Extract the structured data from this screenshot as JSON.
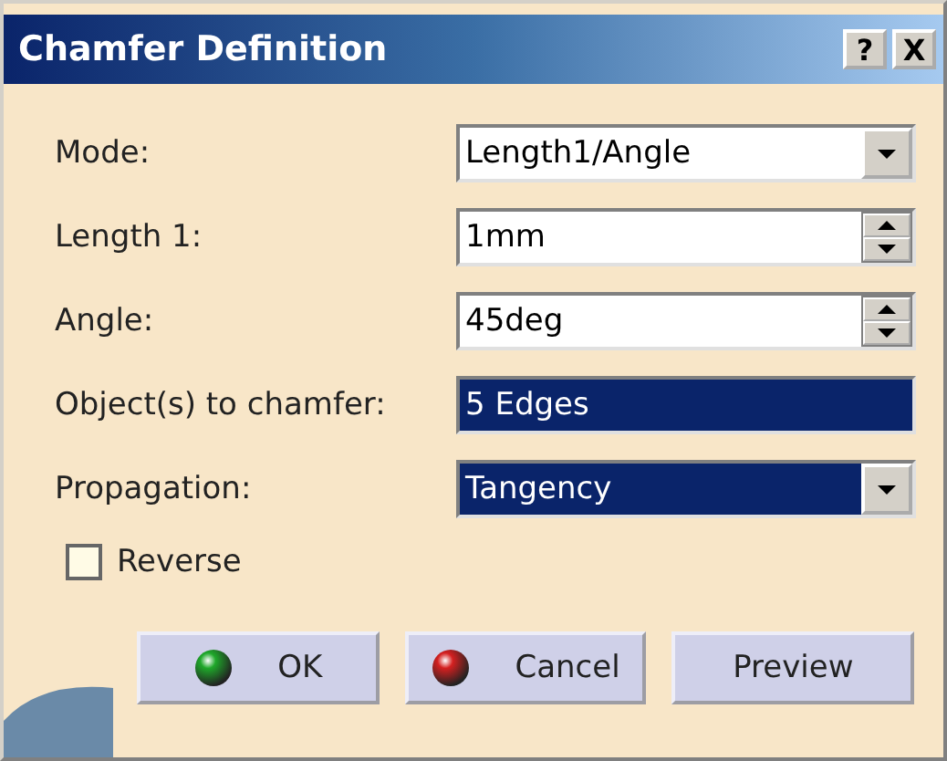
{
  "window": {
    "title": "Chamfer Definition",
    "title_buttons": [
      "?",
      "X"
    ]
  },
  "fields": [
    {
      "kind": "combo",
      "label": "Mode:",
      "value": "Length1/Angle",
      "highlighted": false
    },
    {
      "kind": "spinner",
      "label": "Length 1:",
      "value": "1mm",
      "highlighted": false
    },
    {
      "kind": "spinner",
      "label": "Angle:",
      "value": "45deg",
      "highlighted": false
    },
    {
      "kind": "selection",
      "label": "Object(s) to chamfer:",
      "value": "5 Edges",
      "highlighted": true
    },
    {
      "kind": "combo",
      "label": "Propagation:",
      "value": "Tangency",
      "highlighted": true
    }
  ],
  "reverse": {
    "label": "Reverse",
    "checked": false
  },
  "buttons": [
    {
      "label": "OK",
      "kind": "ok"
    },
    {
      "label": "Cancel",
      "kind": "cancel"
    },
    {
      "label": "Preview",
      "kind": "plain"
    }
  ]
}
